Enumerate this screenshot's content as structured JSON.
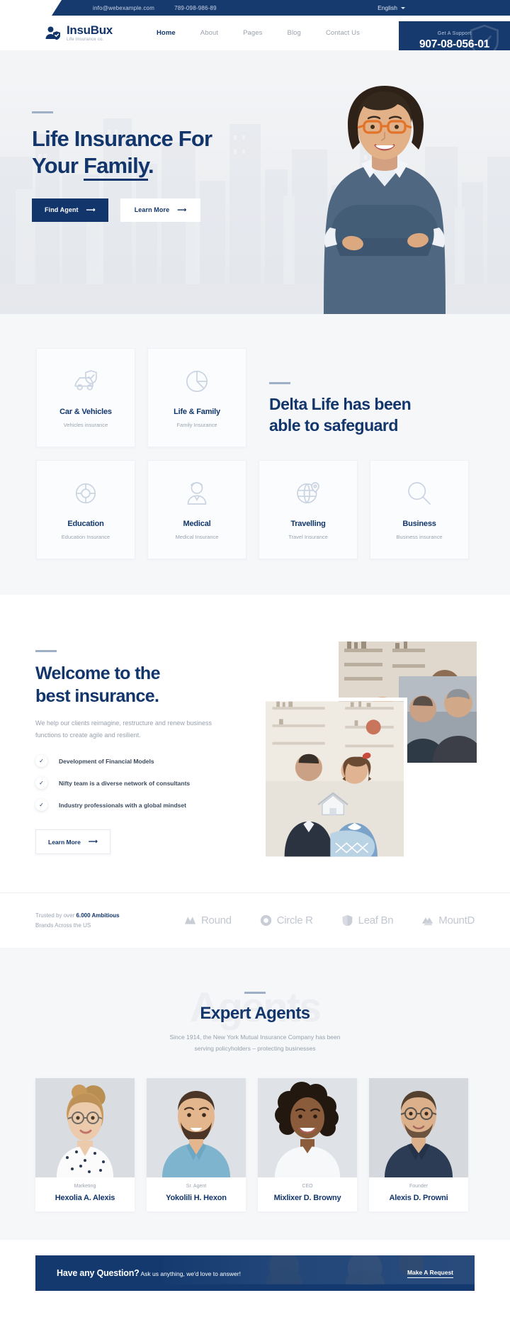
{
  "topbar": {
    "email": "info@webexample.com",
    "phone": "789-098-986-89",
    "language": "English",
    "caret_icon": "chevron-down-icon"
  },
  "nav": {
    "logo_icon": "person-shield-icon",
    "brand_name": "InsuBux",
    "brand_tagline": "Life Insurance co.",
    "items": [
      {
        "label": "Home",
        "active": true
      },
      {
        "label": "About",
        "active": false
      },
      {
        "label": "Pages",
        "active": false
      },
      {
        "label": "Blog",
        "active": false
      },
      {
        "label": "Contact Us",
        "active": false
      }
    ],
    "support": {
      "label": "Get A Support",
      "number": "907-08-056-01",
      "icon": "shield-icon",
      "bg_color": "#173A6E"
    }
  },
  "hero": {
    "title_line1": "Life Insurance For",
    "title_line2_prefix": "Your ",
    "title_line2_underlined": "Family",
    "title_line2_suffix": ".",
    "primary_button": {
      "label": "Find Agent",
      "icon": "arrow-right-icon"
    },
    "secondary_button": {
      "label": "Learn More",
      "icon": "arrow-right-icon"
    },
    "background_alt": "city-skyline",
    "person_alt": "smiling-woman-with-glasses"
  },
  "services": {
    "heading_line1": "Delta Life has been",
    "heading_line2": "able to safeguard",
    "cards": [
      {
        "icon": "car-shield-icon",
        "title": "Car & Vehicles",
        "subtitle": "Vehicles insurance"
      },
      {
        "icon": "pie-chart-icon",
        "title": "Life & Family",
        "subtitle": "Family Insurance"
      },
      {
        "icon": "lifebuoy-icon",
        "title": "Education",
        "subtitle": "Education Insurance"
      },
      {
        "icon": "doctor-icon",
        "title": "Medical",
        "subtitle": "Medical Insurance"
      },
      {
        "icon": "globe-pin-icon",
        "title": "Travelling",
        "subtitle": "Travel Insurance"
      },
      {
        "icon": "magnifier-icon",
        "title": "Business",
        "subtitle": "Business insurance"
      }
    ]
  },
  "welcome": {
    "title_line1": "Welcome to the",
    "title_line2": "best insurance.",
    "paragraph": "We help our clients reimagine, restructure and renew business functions to create agile and resilient.",
    "bullets": [
      "Development of Financial Models",
      "Nifty team is a diverse network of consultants",
      "Industry professionals with a global mindset"
    ],
    "check_icon": "check-icon",
    "button": {
      "label": "Learn More",
      "icon": "arrow-right-icon"
    },
    "images": [
      {
        "alt": "office-shelves-meeting"
      },
      {
        "alt": "two-men-talking"
      },
      {
        "alt": "couple-holding-house-model"
      }
    ]
  },
  "brands": {
    "trust_prefix": "Trusted by over ",
    "trust_highlight": "6.000 Ambitious",
    "trust_line2": "Brands Across the US",
    "logos": [
      {
        "mark": "mountain-m-icon",
        "name": "Round"
      },
      {
        "mark": "circle-ring-icon",
        "name": "Circle R"
      },
      {
        "mark": "leaf-shield-icon",
        "name": "Leaf Bn"
      },
      {
        "mark": "peaks-icon",
        "name": "MountD"
      }
    ]
  },
  "agents": {
    "ghost_word": "Agents",
    "title": "Expert Agents",
    "subtitle_line1": "Since 1914, the New York Mutual Insurance Company has been",
    "subtitle_line2": "serving policyholders – protecting businesses",
    "list": [
      {
        "role": "Marketing",
        "name": "Hexolia A. Alexis",
        "photo_alt": "woman-with-glasses-bun"
      },
      {
        "role": "Sr. Agent",
        "name": "Yokolili H. Hexon",
        "photo_alt": "bearded-man-blue-shirt"
      },
      {
        "role": "CEO",
        "name": "Mixlixer D. Browny",
        "photo_alt": "smiling-woman-curly-hair"
      },
      {
        "role": "Founder",
        "name": "Alexis D. Prowni",
        "photo_alt": "man-with-glasses-navy-shirt"
      }
    ]
  },
  "cta": {
    "headline": "Have any Question?",
    "text": "Ask us anything, we'd love to answer!",
    "link": "Make A Request",
    "photo_alt": "mother-and-baby",
    "bg_color": "#13396f"
  },
  "theme": {
    "brand_blue": "#12356b",
    "dark_blue": "#173A6E",
    "muted_gray": "#9aa4b2",
    "light_bg": "#f6f7f9"
  }
}
